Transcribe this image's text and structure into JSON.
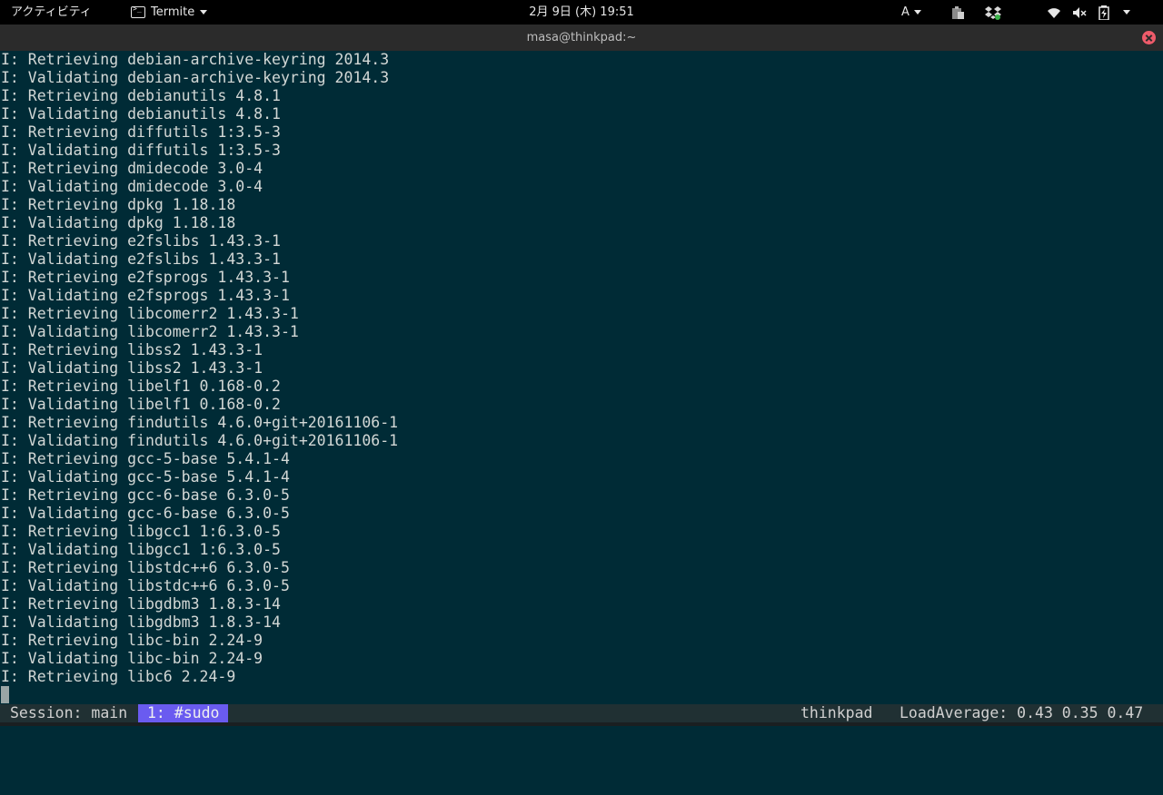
{
  "topbar": {
    "activities_label": "アクティビティ",
    "app_menu_label": "Termite",
    "clock": "2月 9日 (木) 19:51",
    "input_method": "A",
    "icons": [
      "clipboard-icon",
      "dropbox-icon",
      "wifi-icon",
      "volume-muted-icon",
      "battery-charging-icon",
      "system-menu-caret-icon"
    ]
  },
  "window": {
    "title": "masa@thinkpad:~"
  },
  "terminal": {
    "lines": [
      "I: Retrieving debian-archive-keyring 2014.3",
      "I: Validating debian-archive-keyring 2014.3",
      "I: Retrieving debianutils 4.8.1",
      "I: Validating debianutils 4.8.1",
      "I: Retrieving diffutils 1:3.5-3",
      "I: Validating diffutils 1:3.5-3",
      "I: Retrieving dmidecode 3.0-4",
      "I: Validating dmidecode 3.0-4",
      "I: Retrieving dpkg 1.18.18",
      "I: Validating dpkg 1.18.18",
      "I: Retrieving e2fslibs 1.43.3-1",
      "I: Validating e2fslibs 1.43.3-1",
      "I: Retrieving e2fsprogs 1.43.3-1",
      "I: Validating e2fsprogs 1.43.3-1",
      "I: Retrieving libcomerr2 1.43.3-1",
      "I: Validating libcomerr2 1.43.3-1",
      "I: Retrieving libss2 1.43.3-1",
      "I: Validating libss2 1.43.3-1",
      "I: Retrieving libelf1 0.168-0.2",
      "I: Validating libelf1 0.168-0.2",
      "I: Retrieving findutils 4.6.0+git+20161106-1",
      "I: Validating findutils 4.6.0+git+20161106-1",
      "I: Retrieving gcc-5-base 5.4.1-4",
      "I: Validating gcc-5-base 5.4.1-4",
      "I: Retrieving gcc-6-base 6.3.0-5",
      "I: Validating gcc-6-base 6.3.0-5",
      "I: Retrieving libgcc1 1:6.3.0-5",
      "I: Validating libgcc1 1:6.3.0-5",
      "I: Retrieving libstdc++6 6.3.0-5",
      "I: Validating libstdc++6 6.3.0-5",
      "I: Retrieving libgdbm3 1.8.3-14",
      "I: Validating libgdbm3 1.8.3-14",
      "I: Retrieving libc-bin 2.24-9",
      "I: Validating libc-bin 2.24-9",
      "I: Retrieving libc6 2.24-9"
    ]
  },
  "statusbar": {
    "session": "Session: main",
    "window": "1: #sudo",
    "hostname": "thinkpad",
    "load_average": "LoadAverage: 0.43 0.35 0.47"
  },
  "colors": {
    "terminal_bg": "#002b36",
    "terminal_fg": "#d3d8d6",
    "status_window_bg": "#6a5bf0",
    "close_button": "#ef5b6a"
  }
}
